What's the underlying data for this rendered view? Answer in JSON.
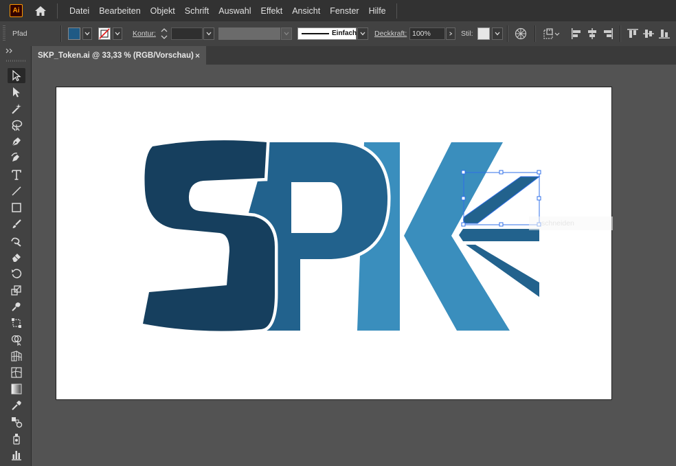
{
  "app": {
    "logo_text": "Ai"
  },
  "menu": [
    "Datei",
    "Bearbeiten",
    "Objekt",
    "Schrift",
    "Auswahl",
    "Effekt",
    "Ansicht",
    "Fenster",
    "Hilfe"
  ],
  "control": {
    "object_type": "Pfad",
    "fill_color": "#1f5a85",
    "stroke_label": "Kontur:",
    "stroke_profile": "Einfach",
    "opacity_label": "Deckkraft:",
    "opacity_value": "100%",
    "style_label": "Stil:"
  },
  "document": {
    "tab_title": "SKP_Token.ai @ 33,33 % (RGB/Vorschau)",
    "close_glyph": "×"
  },
  "canvas": {
    "hint_text": "schneiden",
    "colors": {
      "dark": "#163f5e",
      "mid": "#22628d",
      "light": "#3a8ebd",
      "selection": "#2f6fe8"
    }
  },
  "tools": [
    "selection-tool",
    "direct-selection-tool",
    "magic-wand-tool",
    "lasso-tool",
    "pen-tool",
    "curvature-tool",
    "type-tool",
    "line-tool",
    "rectangle-tool",
    "paintbrush-tool",
    "shaper-tool",
    "eraser-tool",
    "rotate-tool",
    "scale-tool",
    "warp-tool",
    "free-transform-tool",
    "shape-builder-tool",
    "perspective-grid-tool",
    "mesh-tool",
    "gradient-tool",
    "eyedropper-tool",
    "blend-tool",
    "symbol-sprayer-tool",
    "column-graph-tool"
  ]
}
